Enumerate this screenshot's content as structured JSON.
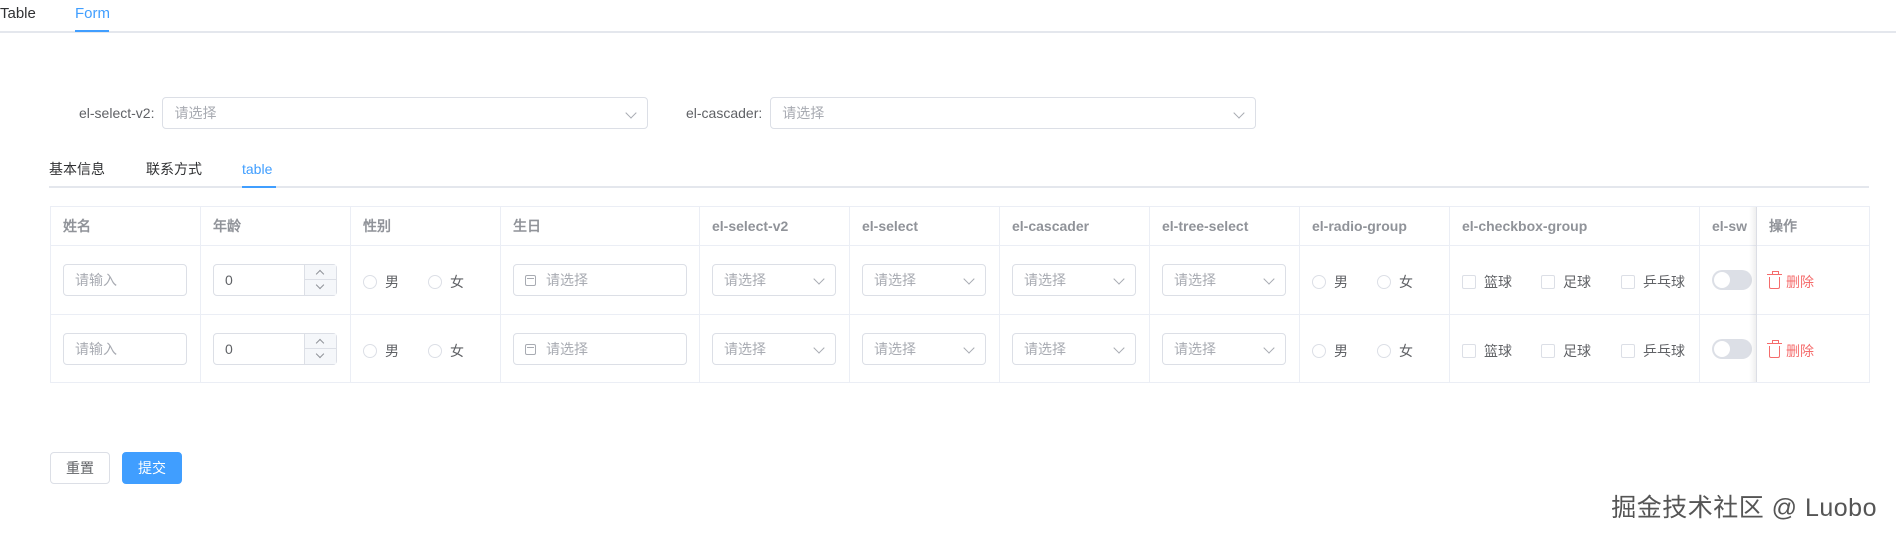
{
  "top_tabs": [
    {
      "label": "Table",
      "active": false
    },
    {
      "label": "Form",
      "active": true
    }
  ],
  "form": {
    "select_v2": {
      "label": "el-select-v2:",
      "placeholder": "请选择"
    },
    "cascader": {
      "label": "el-cascader:",
      "placeholder": "请选择"
    }
  },
  "sub_tabs": [
    {
      "label": "基本信息",
      "active": false
    },
    {
      "label": "联系方式",
      "active": false
    },
    {
      "label": "table",
      "active": true
    }
  ],
  "table": {
    "columns": [
      "姓名",
      "年龄",
      "性别",
      "生日",
      "el-select-v2",
      "el-select",
      "el-cascader",
      "el-tree-select",
      "el-radio-group",
      "el-checkbox-group",
      "el-sw",
      "操作"
    ],
    "rows": [
      {
        "name_placeholder": "请输入",
        "age": "0",
        "gender_options": [
          "男",
          "女"
        ],
        "birthday_placeholder": "请选择",
        "select_v2_placeholder": "请选择",
        "select_placeholder": "请选择",
        "cascader_placeholder": "请选择",
        "tree_select_placeholder": "请选择",
        "radio_options": [
          "男",
          "女"
        ],
        "checkbox_options": [
          "篮球",
          "足球",
          "乒乓球"
        ],
        "switch_on": false,
        "action_label": "删除"
      },
      {
        "name_placeholder": "请输入",
        "age": "0",
        "gender_options": [
          "男",
          "女"
        ],
        "birthday_placeholder": "请选择",
        "select_v2_placeholder": "请选择",
        "select_placeholder": "请选择",
        "cascader_placeholder": "请选择",
        "tree_select_placeholder": "请选择",
        "radio_options": [
          "男",
          "女"
        ],
        "checkbox_options": [
          "篮球",
          "足球",
          "乒乓球"
        ],
        "switch_on": false,
        "action_label": "删除"
      }
    ]
  },
  "buttons": {
    "reset": "重置",
    "submit": "提交"
  },
  "watermark": "掘金技术社区 @ Luobo",
  "colors": {
    "accent": "#409eff",
    "danger": "#f56c6c",
    "border": "#dcdfe6",
    "placeholder": "#a8abb2"
  },
  "icons": {
    "dropdown": "chevron-down-icon",
    "calendar": "calendar-icon",
    "delete": "trash-icon",
    "stepper_up": "chevron-up-icon",
    "stepper_down": "chevron-down-icon"
  }
}
